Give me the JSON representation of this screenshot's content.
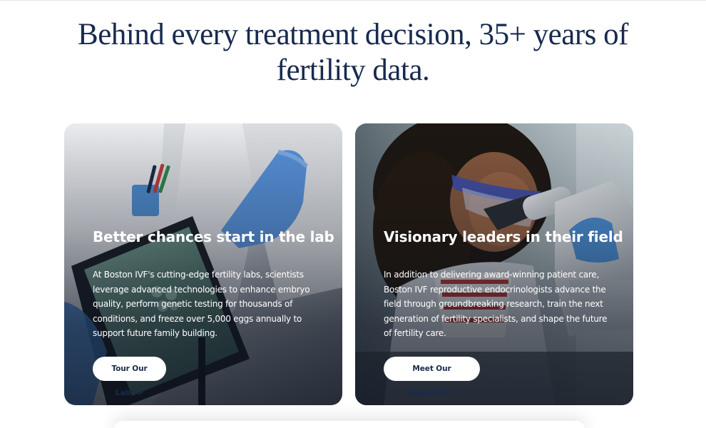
{
  "headline": {
    "line1": "Behind every treatment decision, 35+ years of",
    "line2": "fertility data."
  },
  "cards": [
    {
      "title": "Better chances start in the lab",
      "body": "At Boston IVF's cutting-edge fertility labs, scientists leverage advanced technologies to enhance embryo quality, perform genetic testing for thousands of conditions, and freeze over 5,000 eggs annually to support future family building.",
      "button_label": "Tour Our Labs >",
      "image": "lab-technician-tablet-photo"
    },
    {
      "title": "Visionary leaders in their field",
      "body": "In addition to delivering award-winning patient care, Boston IVF reproductive endocrinologists advance the field through groundbreaking research, train the next generation of fertility specialists, and shape the future of fertility care.",
      "button_label": "Meet Our Specialists >",
      "image": "scientist-microscope-photo"
    }
  ],
  "colors": {
    "navy": "#182a4e",
    "white": "#ffffff"
  }
}
